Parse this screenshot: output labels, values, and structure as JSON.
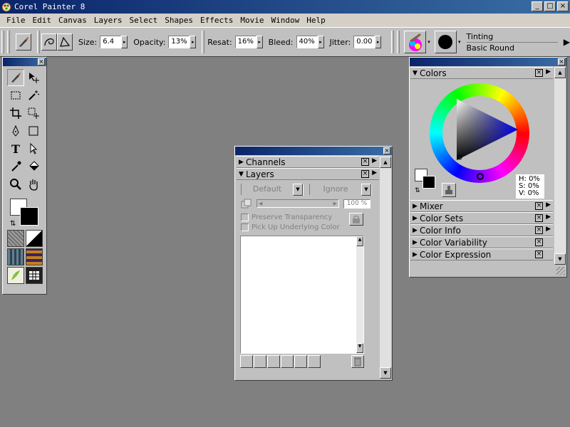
{
  "app": {
    "title": "Corel Painter 8"
  },
  "window_buttons": [
    "_",
    "□",
    "×"
  ],
  "menu": [
    "File",
    "Edit",
    "Canvas",
    "Layers",
    "Select",
    "Shapes",
    "Effects",
    "Movie",
    "Window",
    "Help"
  ],
  "property_bar": {
    "size_label": "Size:",
    "size_value": "6.4",
    "opacity_label": "Opacity:",
    "opacity_value": "13%",
    "resat_label": "Resat:",
    "resat_value": "16%",
    "bleed_label": "Bleed:",
    "bleed_value": "40%",
    "jitter_label": "Jitter:",
    "jitter_value": "0.00",
    "brush_category": "Tinting",
    "brush_variant": "Basic Round"
  },
  "toolbox": {
    "close": "×",
    "tools": [
      "brush-icon",
      "layer-adjuster-icon",
      "rectangular-selection-icon",
      "magic-wand-icon",
      "crop-icon",
      "selection-adjuster-icon",
      "pen-icon",
      "rectangle-shape-icon",
      "text-icon",
      "shape-selection-icon",
      "dropper-icon",
      "paint-bucket-icon",
      "magnifier-icon",
      "grabber-icon"
    ]
  },
  "layers_palette": {
    "close": "×",
    "channels_title": "Channels",
    "layers_title": "Layers",
    "composite_method": "Default",
    "depth_option": "Ignore",
    "opacity_value": "100 %",
    "preserve_transparency": "Preserve Transparency",
    "pick_up_underlying": "Pick Up Underlying Color"
  },
  "colors_palette": {
    "close": "×",
    "title": "Colors",
    "hsv": {
      "h": "H: 0%",
      "s": "S: 0%",
      "v": "V: 0%"
    },
    "sections": [
      "Mixer",
      "Color Sets",
      "Color Info",
      "Color Variability",
      "Color Expression"
    ]
  },
  "colors": {
    "titlebar_start": "#0a246a",
    "titlebar_end": "#3a6ea5",
    "workspace": "#808080",
    "panel": "#c0c0c0"
  }
}
